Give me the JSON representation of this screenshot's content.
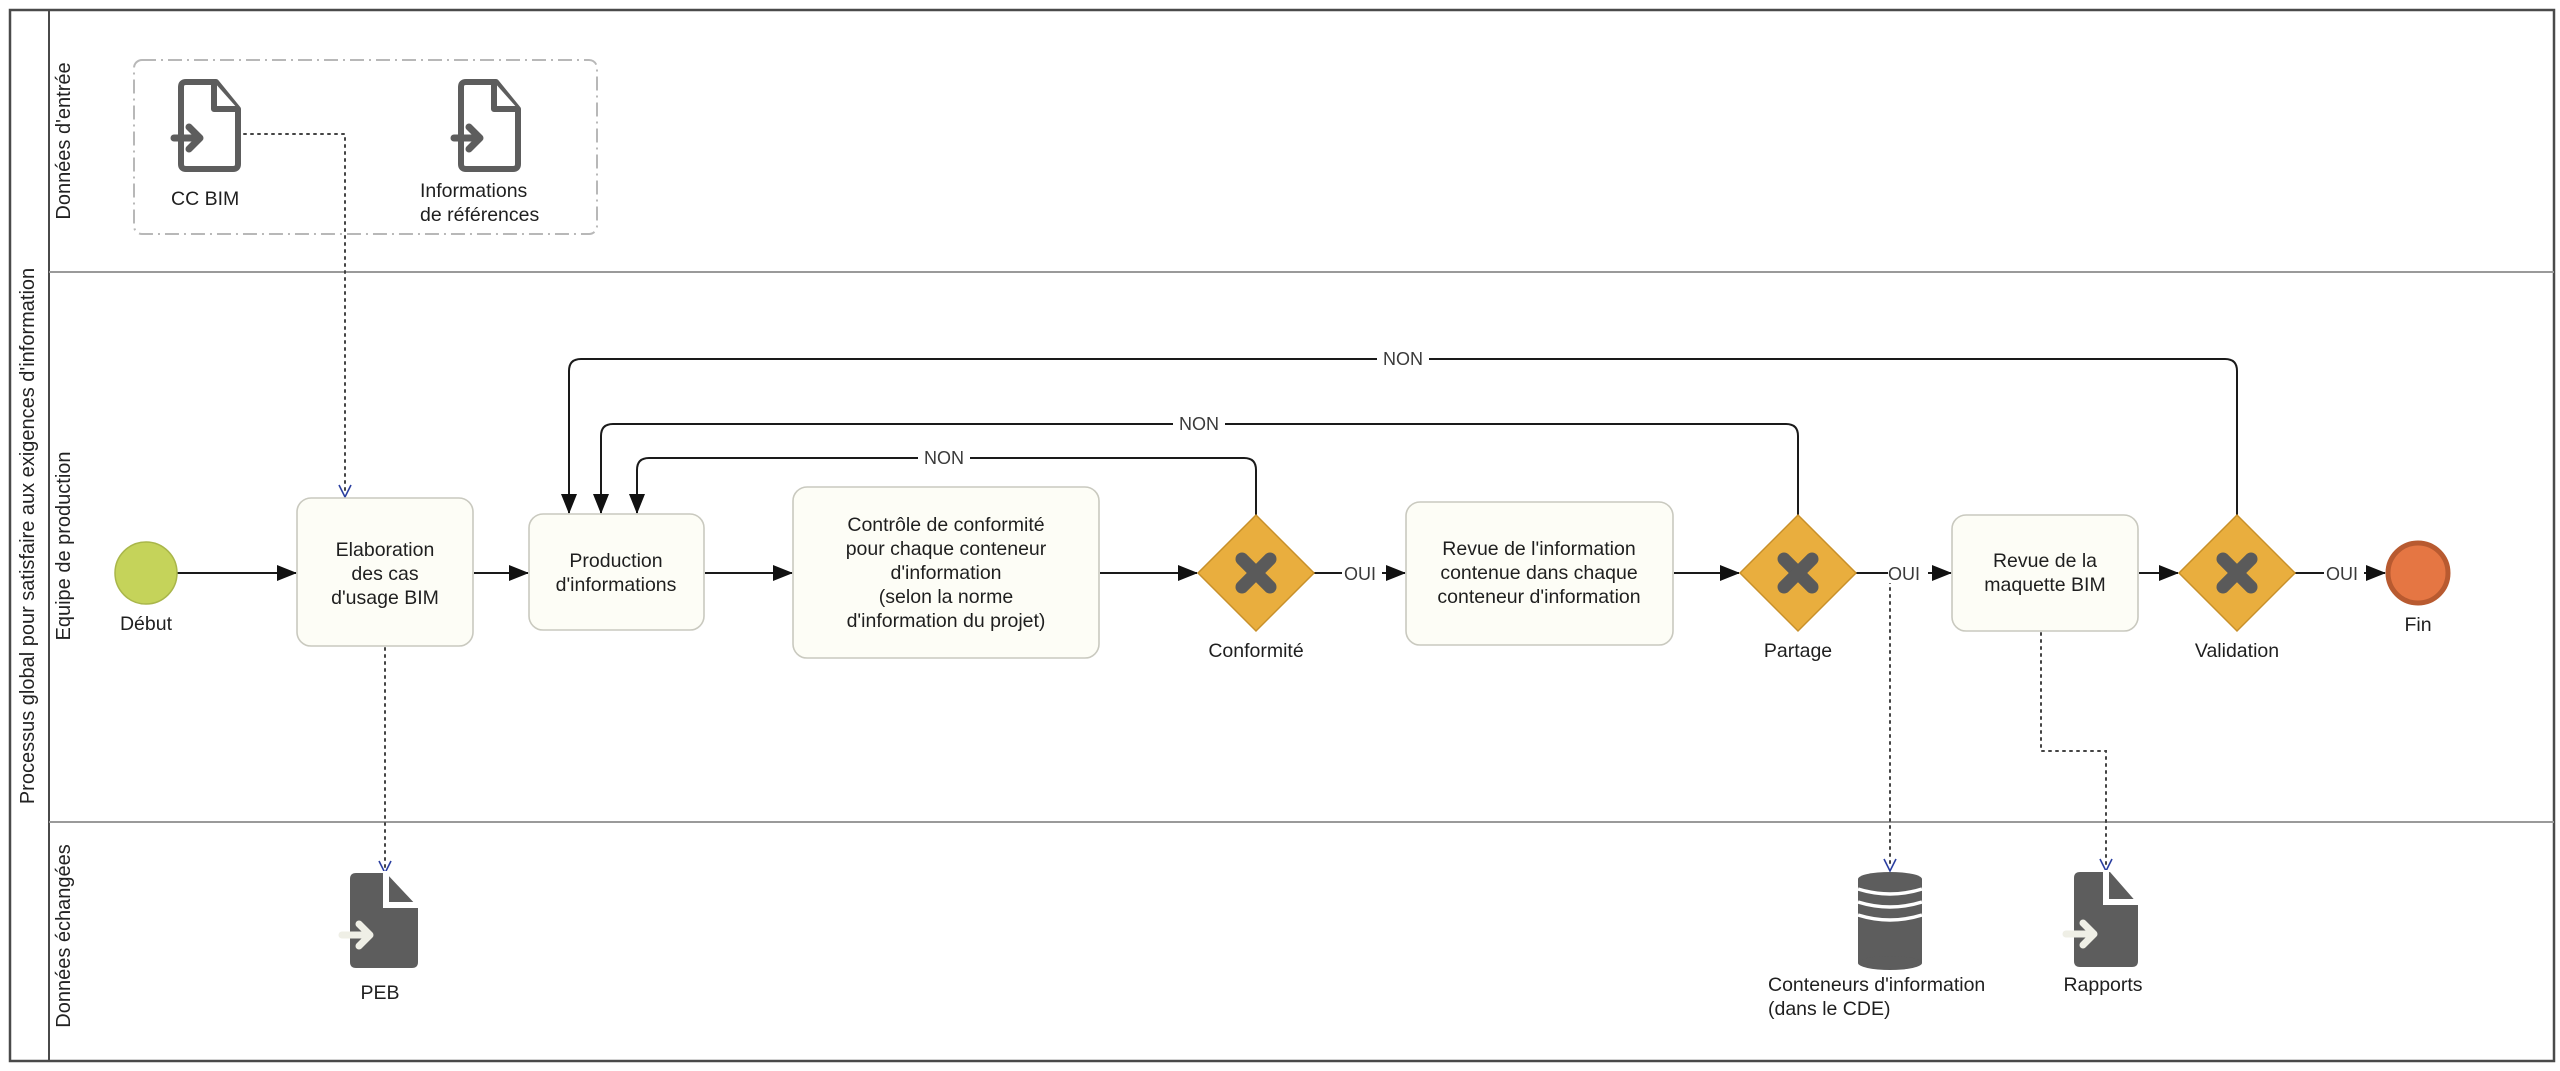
{
  "pool": {
    "title": "Processus global pour satisfaire aux exigences d'information"
  },
  "lanes": [
    {
      "id": "input",
      "label": "Données d'entrée"
    },
    {
      "id": "production",
      "label": "Equipe de production"
    },
    {
      "id": "exchanged",
      "label": "Données échangées"
    }
  ],
  "inputs": {
    "cc_bim": {
      "label": "CC BIM",
      "icon": "document-input-icon"
    },
    "references": {
      "lines": [
        "Informations",
        "de références"
      ],
      "icon": "document-input-icon"
    }
  },
  "events": {
    "start": {
      "label": "Début",
      "color": "#c5d35a"
    },
    "end": {
      "label": "Fin",
      "color": "#e57643"
    }
  },
  "tasks": {
    "elaboration": {
      "lines": [
        "Elaboration",
        "des cas",
        "d'usage BIM"
      ]
    },
    "production": {
      "lines": [
        "Production",
        "d'informations"
      ]
    },
    "controle": {
      "lines": [
        "Contrôle de conformité",
        "pour chaque conteneur",
        "d'information",
        "(selon la norme",
        "d'information du projet)"
      ]
    },
    "revue_info": {
      "lines": [
        "Revue de l'information",
        "contenue dans chaque",
        "conteneur d'information"
      ]
    },
    "revue_maquette": {
      "lines": [
        "Revue de la",
        "maquette BIM"
      ]
    }
  },
  "gateways": {
    "conformite": {
      "label": "Conformité",
      "icon": "exclusive-gateway-x-icon",
      "color": "#e9ae3e"
    },
    "partage": {
      "label": "Partage",
      "icon": "exclusive-gateway-x-icon",
      "color": "#e9ae3e"
    },
    "validation": {
      "label": "Validation",
      "icon": "exclusive-gateway-x-icon",
      "color": "#e9ae3e"
    }
  },
  "flow_labels": {
    "yes": "OUI",
    "no": "NON"
  },
  "outputs": {
    "peb": {
      "label": "PEB",
      "icon": "document-output-icon"
    },
    "conteneurs": {
      "lines": [
        "Conteneurs d'information",
        "(dans le CDE)"
      ],
      "icon": "database-icon"
    },
    "rapports": {
      "label": "Rapports",
      "icon": "document-output-icon"
    }
  }
}
